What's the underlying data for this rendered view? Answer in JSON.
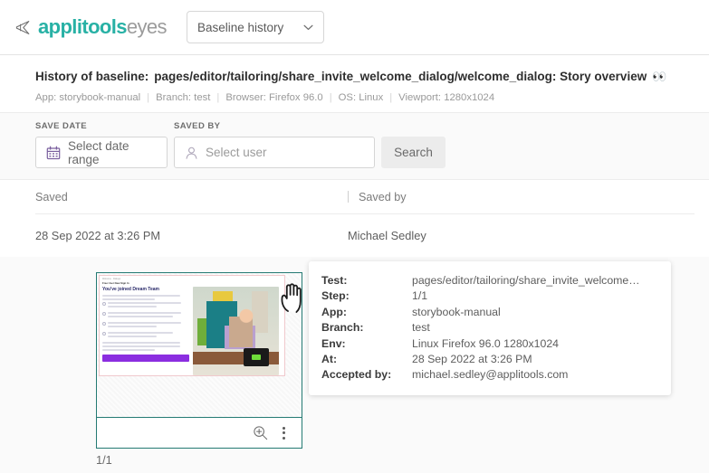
{
  "brand": {
    "name_bold": "applitools",
    "name_light": "eyes",
    "logo_icon": "applitools-dart-icon"
  },
  "topbar": {
    "view_selector": {
      "value": "Baseline history",
      "chevron_icon": "chevron-down-icon"
    }
  },
  "header": {
    "title_label": "History of baseline:",
    "title_path": "pages/editor/tailoring/share_invite_welcome_dialog/welcome_dialog: Story overview",
    "title_emoji": "👀",
    "meta": [
      "App: storybook-manual",
      "Branch: test",
      "Browser: Firefox 96.0",
      "OS: Linux",
      "Viewport: 1280x1024"
    ],
    "separator": "|"
  },
  "filters": {
    "save_date": {
      "label": "SAVE DATE",
      "placeholder": "Select date range",
      "icon": "calendar-icon"
    },
    "saved_by": {
      "label": "SAVED BY",
      "placeholder": "Select user",
      "icon": "user-icon"
    },
    "search_button": "Search"
  },
  "table": {
    "columns": [
      "Saved",
      "Saved by"
    ],
    "rows": [
      {
        "saved": "28 Sep 2022 at 3:26 PM",
        "saved_by": "Michael Sedley"
      }
    ]
  },
  "detail": {
    "page_count": "1/1",
    "toolbar": {
      "zoom_icon": "magnifier-plus-icon",
      "menu_icon": "kebab-menu-icon"
    },
    "thumbnail": {
      "breadcrumb_small": "Welcome · Dialogs",
      "breadcrumb_bold": "Free User New Sign In",
      "heading": "You've joined Dream Team",
      "cta_label": ""
    },
    "cursor_icon": "pointing-hand-cursor"
  },
  "tooltip": {
    "rows": [
      {
        "key": "Test:",
        "value": "pages/editor/tailoring/share_invite_welcome…"
      },
      {
        "key": "Step:",
        "value": "1/1"
      },
      {
        "key": "App:",
        "value": "storybook-manual"
      },
      {
        "key": "Branch:",
        "value": "test"
      },
      {
        "key": "Env:",
        "value": "Linux Firefox 96.0 1280x1024"
      },
      {
        "key": "At:",
        "value": "28 Sep 2022 at 3:26 PM"
      },
      {
        "key": "Accepted by:",
        "value": "michael.sedley@applitools.com"
      }
    ]
  },
  "colors": {
    "brand_teal": "#28b1a5",
    "card_border": "#247a73",
    "page_bg": "#fafafa"
  }
}
